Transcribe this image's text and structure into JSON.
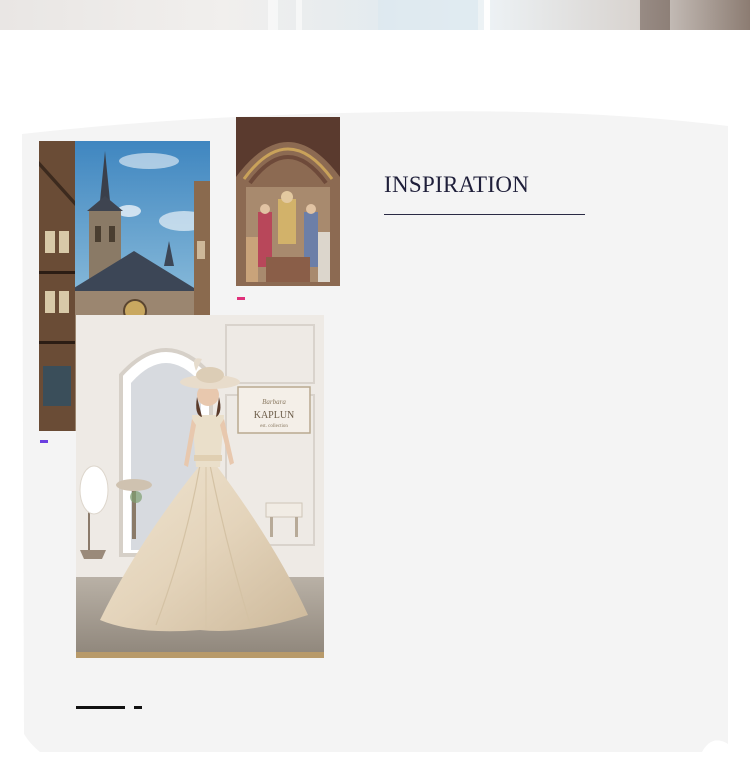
{
  "page": {
    "title": "INSPIRATION"
  },
  "colors": {
    "background": "#ffffff",
    "panel": "#f4f4f4",
    "title": "#1f1f3a",
    "accent_purple": "#6b3fe0",
    "accent_pink": "#e0307a",
    "accent_gold": "#b89a6a",
    "ink": "#111111"
  },
  "images": {
    "cathedral": {
      "icon": "gothic-cathedral-photo"
    },
    "mural": {
      "icon": "byzantine-mural-photo"
    },
    "gown": {
      "icon": "ballgown-photo",
      "sign_brand": "KAPLUN",
      "sign_script": "Barbara",
      "sign_sub": "est. collection"
    }
  }
}
